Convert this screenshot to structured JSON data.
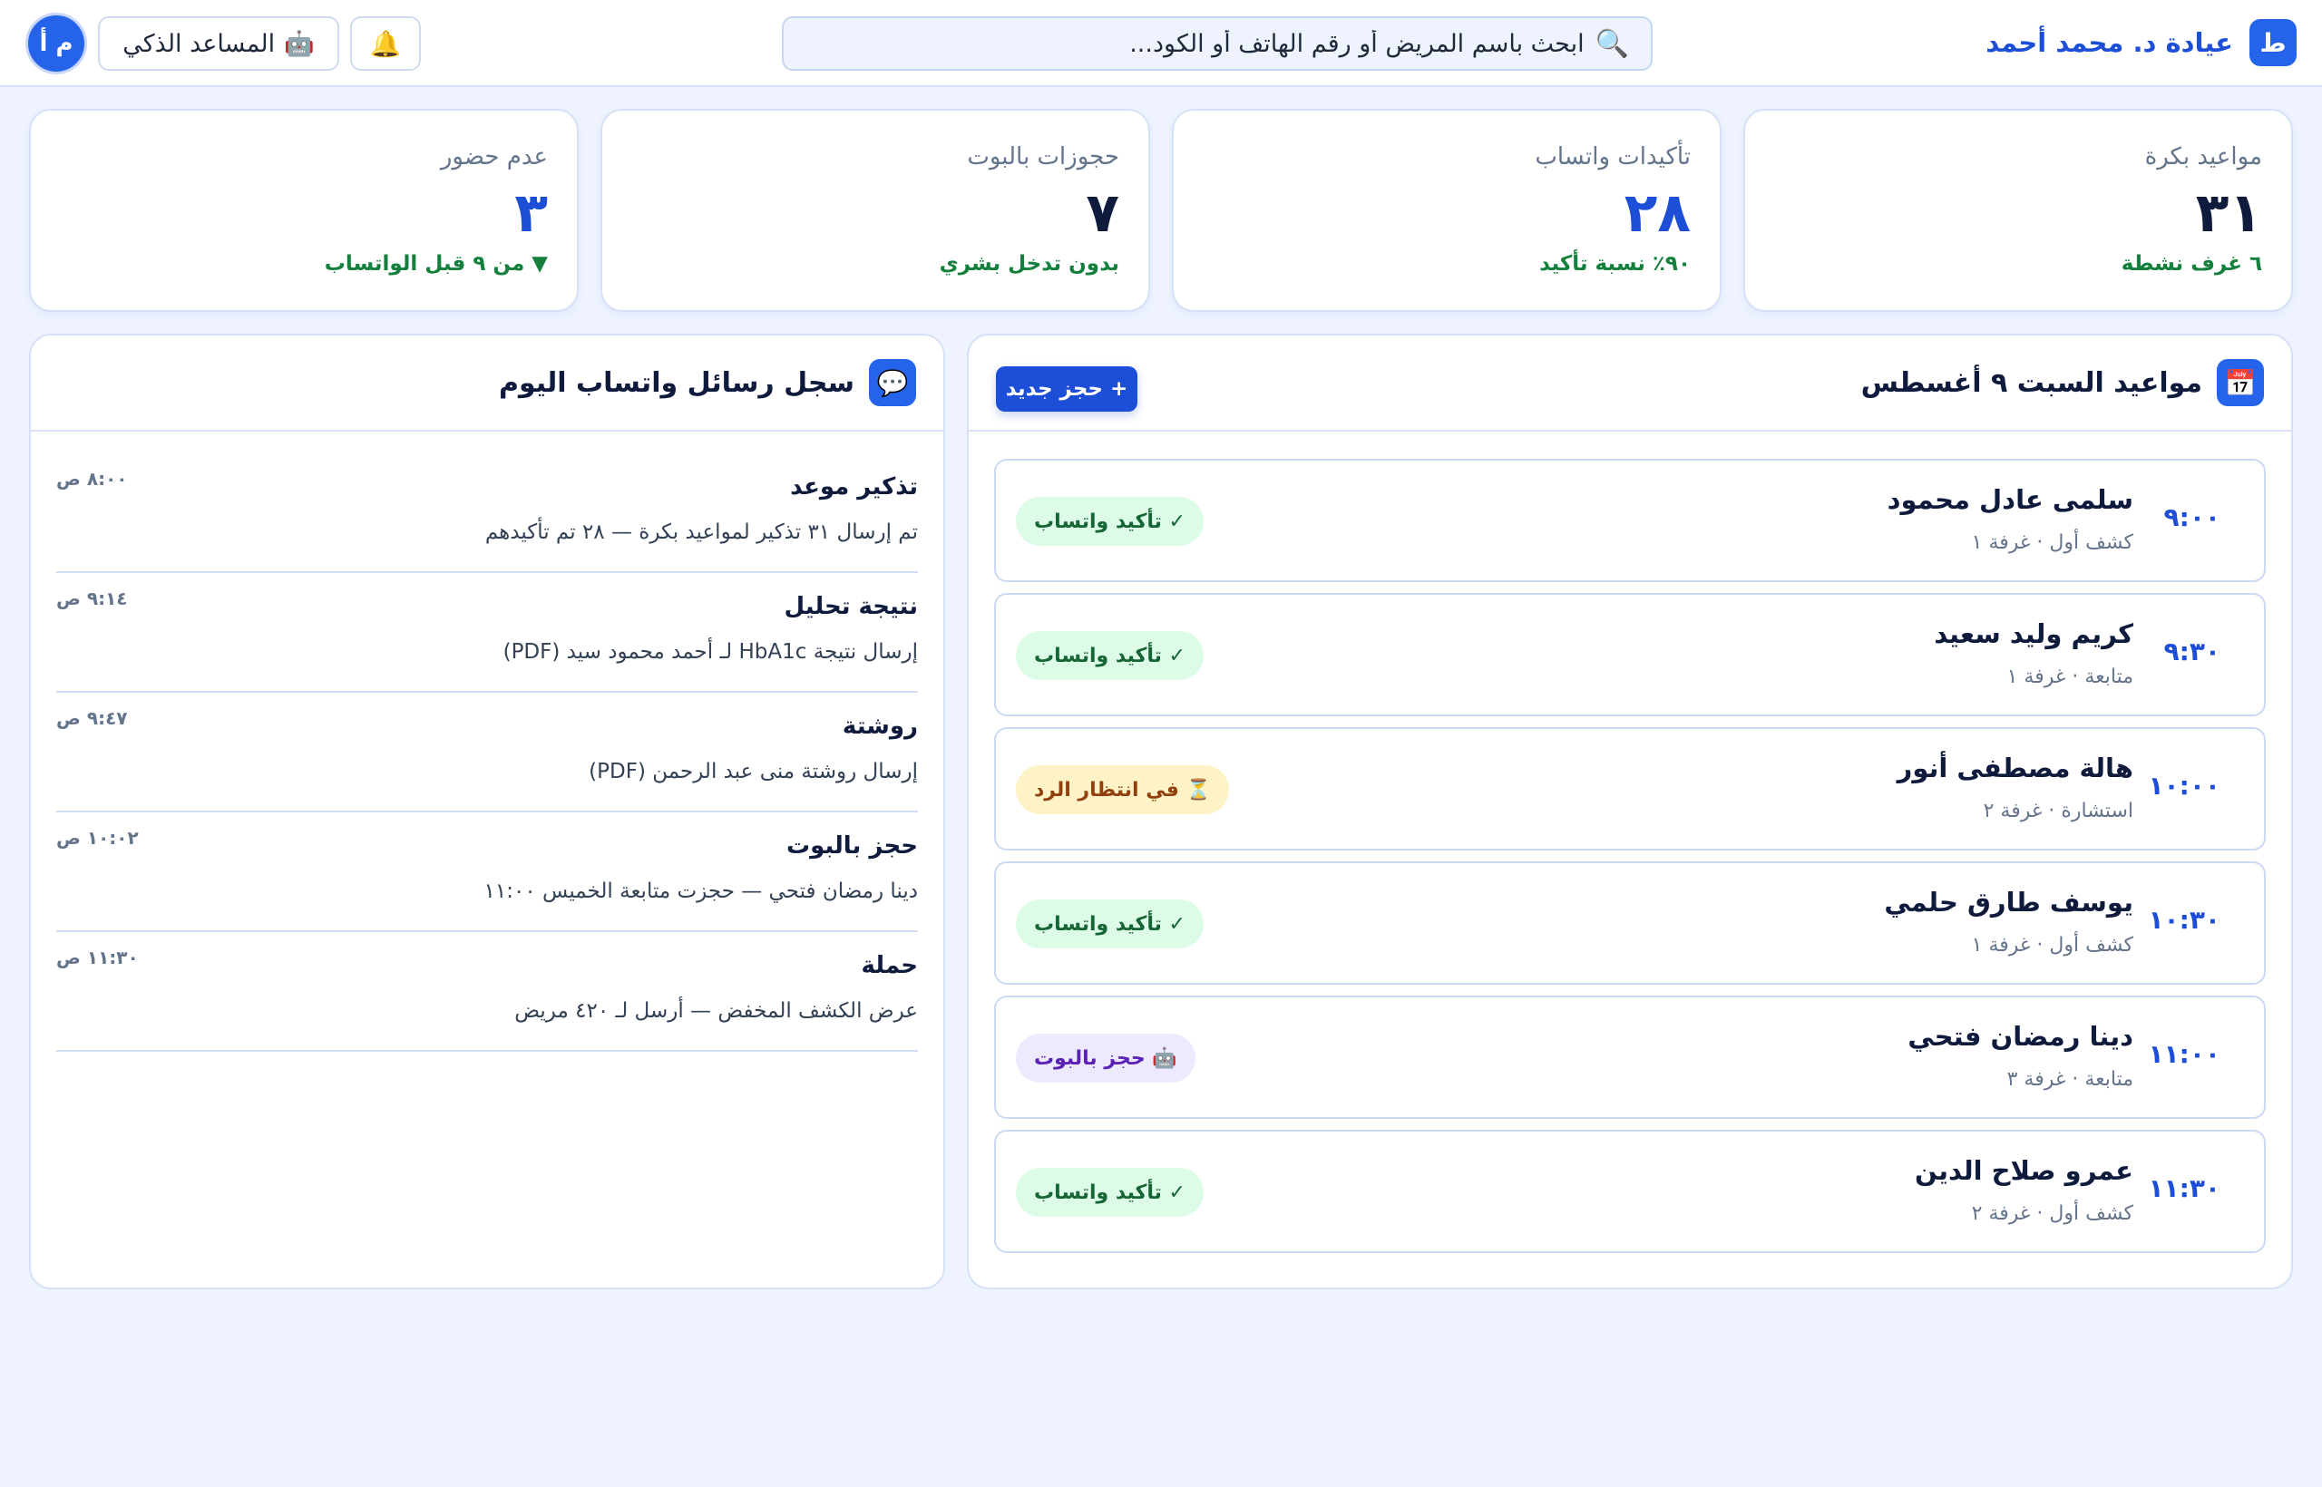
{
  "header": {
    "logo_letter": "ط",
    "clinic_name": "عيادة د. محمد أحمد",
    "search_placeholder": "ابحث باسم المريض أو رقم الهاتف أو الكود...",
    "search_icon": "🔍",
    "bell_icon": "🔔",
    "assistant_icon": "🤖",
    "assistant_label": "المساعد الذكي",
    "avatar_initials": "م أ"
  },
  "stats": [
    {
      "label": "مواعيد بكرة",
      "value": "٣١",
      "note": "٦ غرف نشطة",
      "value_color": "#0f1b3d"
    },
    {
      "label": "تأكيدات واتساب",
      "value": "٢٨",
      "note": "٩٠٪ نسبة تأكيد",
      "value_color": "#1d4ed8"
    },
    {
      "label": "حجوزات بالبوت",
      "value": "٧",
      "note": "بدون تدخل بشري",
      "value_color": "#0f1b3d"
    },
    {
      "label": "عدم حضور",
      "value": "٣",
      "note": "▼ من ٩ قبل الواتساب",
      "value_color": "#1d4ed8"
    }
  ],
  "appointments_panel": {
    "icon": "📅",
    "title": "مواعيد السبت ٩ أغسطس",
    "new_button": "+ حجز جديد",
    "items": [
      {
        "time": "٩:٠٠",
        "name": "سلمى عادل محمود",
        "meta": "كشف أول · غرفة ١",
        "badge": "✓ تأكيد واتساب",
        "badge_type": "green"
      },
      {
        "time": "٩:٣٠",
        "name": "كريم وليد سعيد",
        "meta": "متابعة · غرفة ١",
        "badge": "✓ تأكيد واتساب",
        "badge_type": "green"
      },
      {
        "time": "١٠:٠٠",
        "name": "هالة مصطفى أنور",
        "meta": "استشارة · غرفة ٢",
        "badge": "⏳ في انتظار الرد",
        "badge_type": "yellow"
      },
      {
        "time": "١٠:٣٠",
        "name": "يوسف طارق حلمي",
        "meta": "كشف أول · غرفة ١",
        "badge": "✓ تأكيد واتساب",
        "badge_type": "green"
      },
      {
        "time": "١١:٠٠",
        "name": "دينا رمضان فتحي",
        "meta": "متابعة · غرفة ٣",
        "badge": "🤖 حجز بالبوت",
        "badge_type": "purple"
      },
      {
        "time": "١١:٣٠",
        "name": "عمرو صلاح الدين",
        "meta": "كشف أول · غرفة ٢",
        "badge": "✓ تأكيد واتساب",
        "badge_type": "green"
      }
    ]
  },
  "messages_panel": {
    "icon": "💬",
    "title": "سجل رسائل واتساب اليوم",
    "items": [
      {
        "type": "تذكير موعد",
        "text": "تم إرسال ٣١ تذكير لمواعيد بكرة — ٢٨ تم تأكيدهم",
        "time": "٨:٠٠ ص"
      },
      {
        "type": "نتيجة تحليل",
        "text": "إرسال نتيجة HbA1c لـ أحمد محمود سيد (PDF)",
        "time": "٩:١٤ ص"
      },
      {
        "type": "روشتة",
        "text": "إرسال روشتة منى عبد الرحمن (PDF)",
        "time": "٩:٤٧ ص"
      },
      {
        "type": "حجز بالبوت",
        "text": "دينا رمضان فتحي — حجزت متابعة الخميس ١١:٠٠",
        "time": "١٠:٠٢ ص"
      },
      {
        "type": "حملة",
        "text": "عرض الكشف المخفض — أرسل لـ ٤٢٠ مريض",
        "time": "١١:٣٠ ص"
      }
    ]
  }
}
